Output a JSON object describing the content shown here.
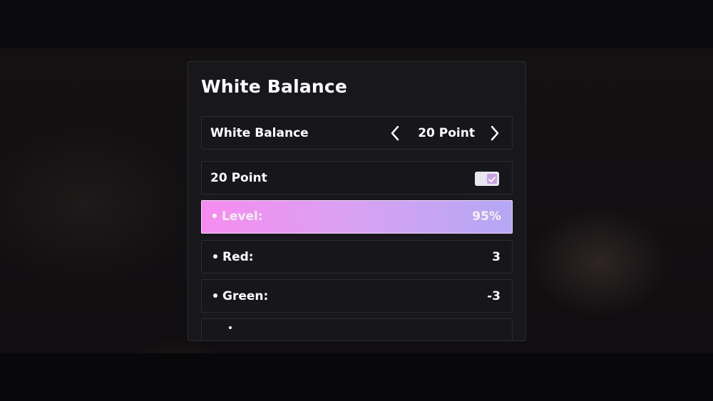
{
  "panel": {
    "title": "White Balance"
  },
  "white_balance_row": {
    "label": "White Balance",
    "value": "20 Point",
    "prev_icon": "chevron-left-icon",
    "next_icon": "chevron-right-icon"
  },
  "twenty_point_row": {
    "label": "20 Point",
    "toggle_state": "on",
    "icon": "checkbox-checked-icon"
  },
  "settings": [
    {
      "label": "Level:",
      "value": "95%",
      "selected": true
    },
    {
      "label": "Red:",
      "value": "3",
      "selected": false
    },
    {
      "label": "Green:",
      "value": "-3",
      "selected": false
    }
  ],
  "colors": {
    "panel_bg": "#18171c",
    "highlight_start": "#f78cf0",
    "highlight_end": "#b3a7f4",
    "toggle_check": "#c8a2e6"
  }
}
